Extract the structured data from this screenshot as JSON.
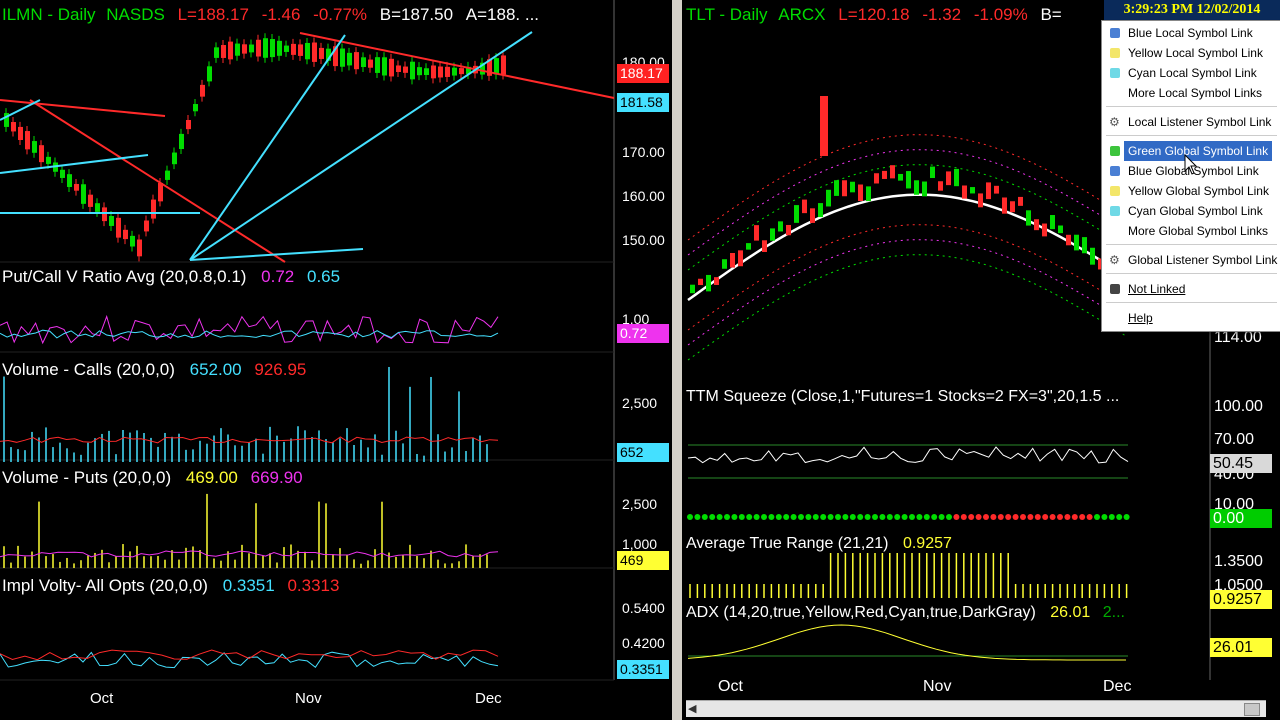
{
  "left_chart": {
    "symbol": "ILMN - Daily",
    "exchange": "NASDS",
    "last": "L=188.17",
    "change": "-1.46",
    "change_pct": "-0.77%",
    "bid": "B=187.50",
    "ask": "A=188. ...",
    "price_axis": [
      "180.00",
      "170.00",
      "160.00",
      "150.00"
    ],
    "last_tag": "188.17",
    "level_tag": "181.58",
    "pcr_title": "Put/Call V Ratio Avg (20,0.8,0.1)",
    "pcr_v1": "0.72",
    "pcr_v2": "0.65",
    "pcr_axis": "1.00",
    "pcr_tag": "0.72",
    "calls_title": "Volume - Calls (20,0,0)",
    "calls_v1": "652.00",
    "calls_v2": "926.95",
    "calls_axis": "2,500",
    "calls_tag": "652",
    "puts_title": "Volume - Puts (20,0,0)",
    "puts_v1": "469.00",
    "puts_v2": "669.90",
    "puts_axis": "2,500",
    "puts_axis2": "1,000",
    "puts_tag": "469",
    "iv_title": "Impl Volty- All Opts (20,0,0)",
    "iv_v1": "0.3351",
    "iv_v2": "0.3313",
    "iv_axis1": "0.5400",
    "iv_axis2": "0.4200",
    "iv_tag": "0.3351",
    "dates": [
      "Oct",
      "Nov",
      "Dec"
    ]
  },
  "right_chart": {
    "symbol": "TLT - Daily",
    "exchange": "ARCX",
    "last": "L=120.18",
    "change": "-1.32",
    "change_pct": "-1.09%",
    "bid": "B=",
    "price_axis": "114.00",
    "ttm_title": "TTM Squeeze (Close,1,\"Futures=1 Stocks=2 FX=3\",20,1.5 ...",
    "ttm_axis": [
      "100.00",
      "70.00",
      "40.00",
      "10.00"
    ],
    "ttm_tag": "50.45",
    "squeeze_tag": "0.00",
    "atr_title": "Average True Range (21,21)",
    "atr_v1": "0.9257",
    "atr_axis": [
      "1.3500",
      "1.0500"
    ],
    "atr_tag": "0.9257",
    "adx_title": "ADX (14,20,true,Yellow,Red,Cyan,true,DarkGray)",
    "adx_v1": "26.01",
    "adx_v2": "2...",
    "adx_tag": "26.01",
    "dates": [
      "Oct",
      "Nov",
      "Dec"
    ]
  },
  "clock": "3:29:23 PM 12/02/2014",
  "menu": {
    "items": [
      {
        "label": "Blue Local Symbol Link",
        "color": "#4a7fd4"
      },
      {
        "label": "Yellow Local Symbol Link",
        "color": "#f3e66a"
      },
      {
        "label": "Cyan Local Symbol Link",
        "color": "#6fd9e6"
      },
      {
        "label": "More Local Symbol Links",
        "color": ""
      },
      {
        "label": "Local Listener Symbol Link",
        "color": "gear"
      },
      {
        "label": "Green Global Symbol Link",
        "color": "#3cc43c"
      },
      {
        "label": "Blue Global Symbol Link",
        "color": "#4a7fd4"
      },
      {
        "label": "Yellow Global Symbol Link",
        "color": "#f3e66a"
      },
      {
        "label": "Cyan Global Symbol Link",
        "color": "#6fd9e6"
      },
      {
        "label": "More Global Symbol Links",
        "color": ""
      },
      {
        "label": "Global Listener Symbol Link",
        "color": "gear"
      },
      {
        "label": "Not Linked",
        "color": "#444444"
      },
      {
        "label": "Help",
        "color": ""
      }
    ]
  },
  "colors": {
    "green": "#00dd00",
    "red": "#ff2a2a",
    "cyan": "#44e0ff",
    "magenta": "#ee33ee",
    "yellow": "#ffff33",
    "white": "#ffffff",
    "menu_highlight": "#316ac5"
  }
}
